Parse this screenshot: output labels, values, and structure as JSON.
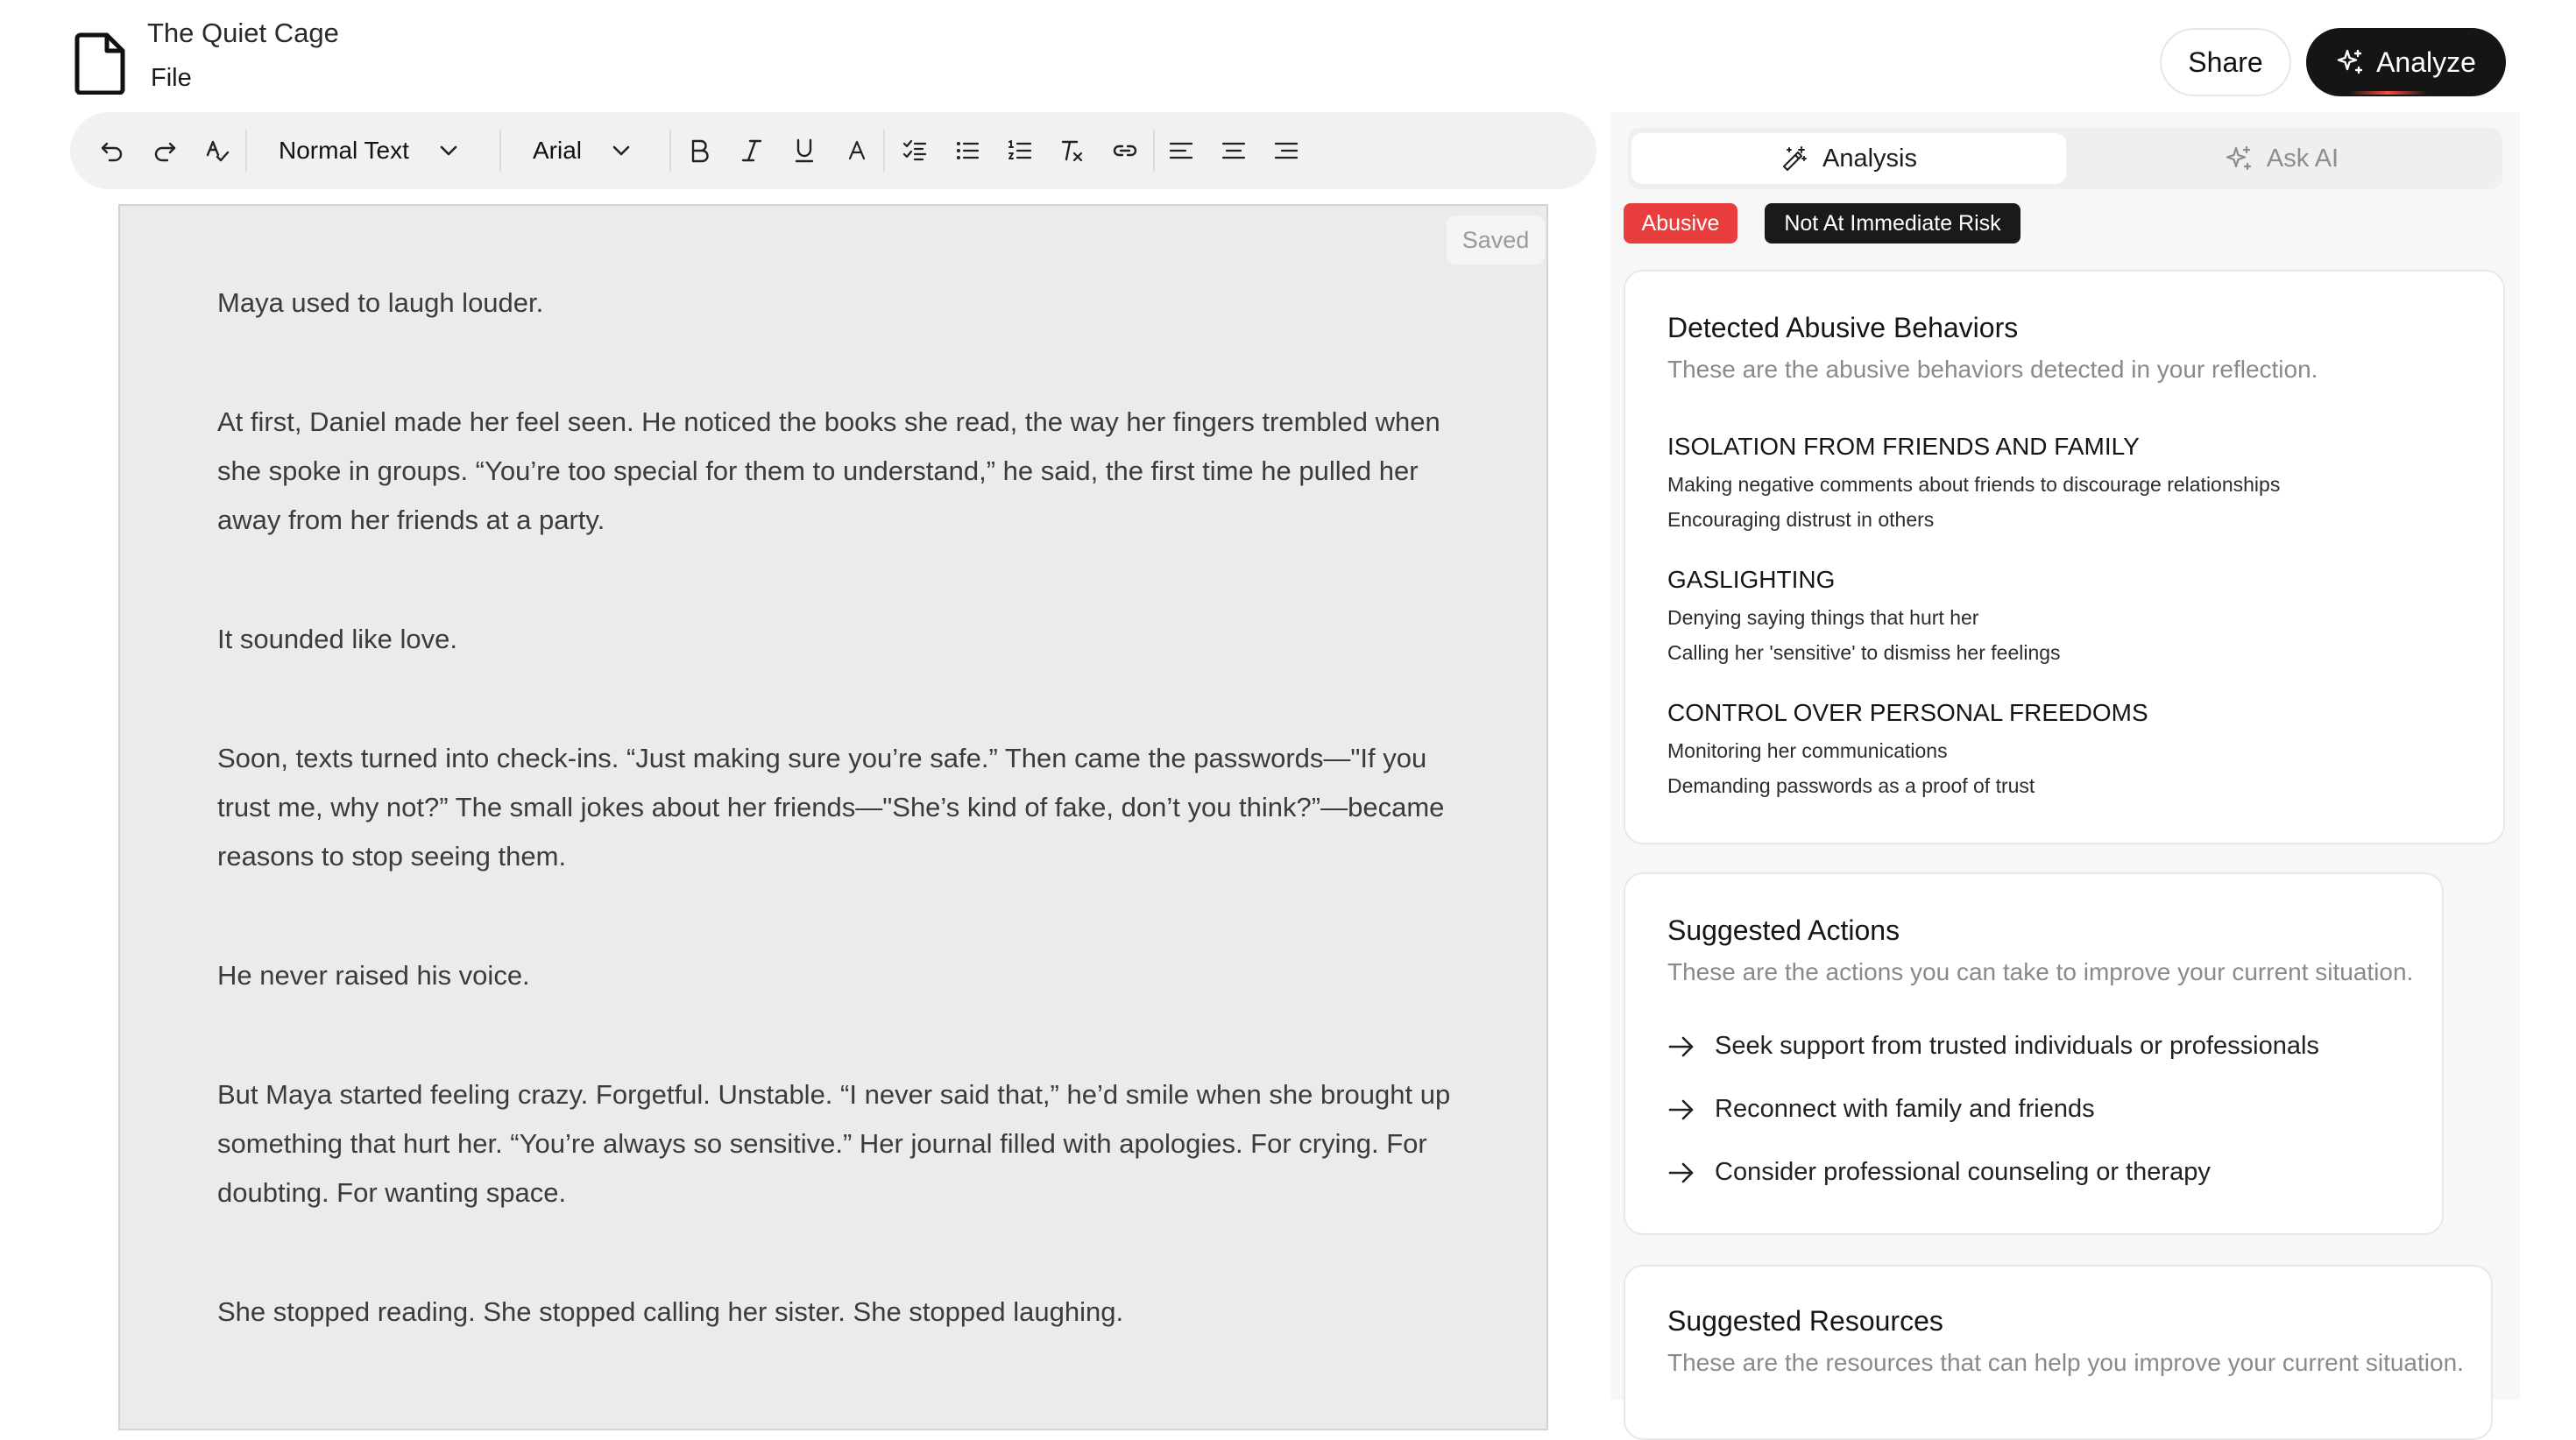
{
  "header": {
    "doc_title": "The Quiet Cage",
    "file_menu": "File",
    "share_label": "Share",
    "analyze_label": "Analyze"
  },
  "toolbar": {
    "text_style": "Normal Text",
    "font_family": "Arial",
    "icons": [
      "undo-icon",
      "redo-icon",
      "spellcheck-icon",
      "bold-icon",
      "italic-icon",
      "underline-icon",
      "text-color-icon",
      "checklist-icon",
      "bullet-list-icon",
      "numbered-list-icon",
      "clear-format-icon",
      "link-icon",
      "align-left-icon",
      "align-center-icon",
      "align-right-icon"
    ]
  },
  "editor": {
    "status": "Saved",
    "paragraphs": [
      "Maya used to laugh louder.",
      "At first, Daniel made her feel seen. He noticed the books she read, the way her fingers trembled when she spoke in groups. “You’re too special for them to understand,” he said, the first time he pulled her away from her friends at a party.",
      "It sounded like love.",
      "Soon, texts turned into check-ins. “Just making sure you’re safe.” Then came the passwords—\"If you trust me, why not?” The small jokes about her friends—\"She’s kind of fake, don’t you think?”—became reasons to stop seeing them.",
      "He never raised his voice.",
      "But Maya started feeling crazy. Forgetful. Unstable. “I never said that,” he’d smile when she brought up something that hurt her. “You’re always so sensitive.” Her journal filled with apologies. For crying. For doubting. For wanting space.",
      "She stopped reading. She stopped calling her sister. She stopped laughing."
    ]
  },
  "panel": {
    "tabs": [
      {
        "label": "Analysis",
        "active": true
      },
      {
        "label": "Ask AI",
        "active": false
      }
    ],
    "badges": {
      "abusive": "Abusive",
      "risk": "Not At Immediate Risk",
      "abusive_color": "#ea3e3e",
      "risk_color": "#1a1a1a"
    },
    "behaviors": {
      "title": "Detected Abusive Behaviors",
      "subtitle": "These are the abusive behaviors detected in your reflection.",
      "categories": [
        {
          "name": "ISOLATION FROM FRIENDS AND FAMILY",
          "items": [
            "Making negative comments about friends to discourage relationships",
            "Encouraging distrust in others"
          ]
        },
        {
          "name": "GASLIGHTING",
          "items": [
            "Denying saying things that hurt her",
            "Calling her 'sensitive' to dismiss her feelings"
          ]
        },
        {
          "name": "CONTROL OVER PERSONAL FREEDOMS",
          "items": [
            "Monitoring her communications",
            "Demanding passwords as a proof of trust"
          ]
        }
      ]
    },
    "actions": {
      "title": "Suggested Actions",
      "subtitle": "These are the actions you can take to improve your current situation.",
      "items": [
        "Seek support from trusted individuals or professionals",
        "Reconnect with family and friends",
        "Consider professional counseling or therapy"
      ]
    },
    "resources": {
      "title": "Suggested Resources",
      "subtitle": "These are the resources that can help you improve your current situation."
    }
  }
}
